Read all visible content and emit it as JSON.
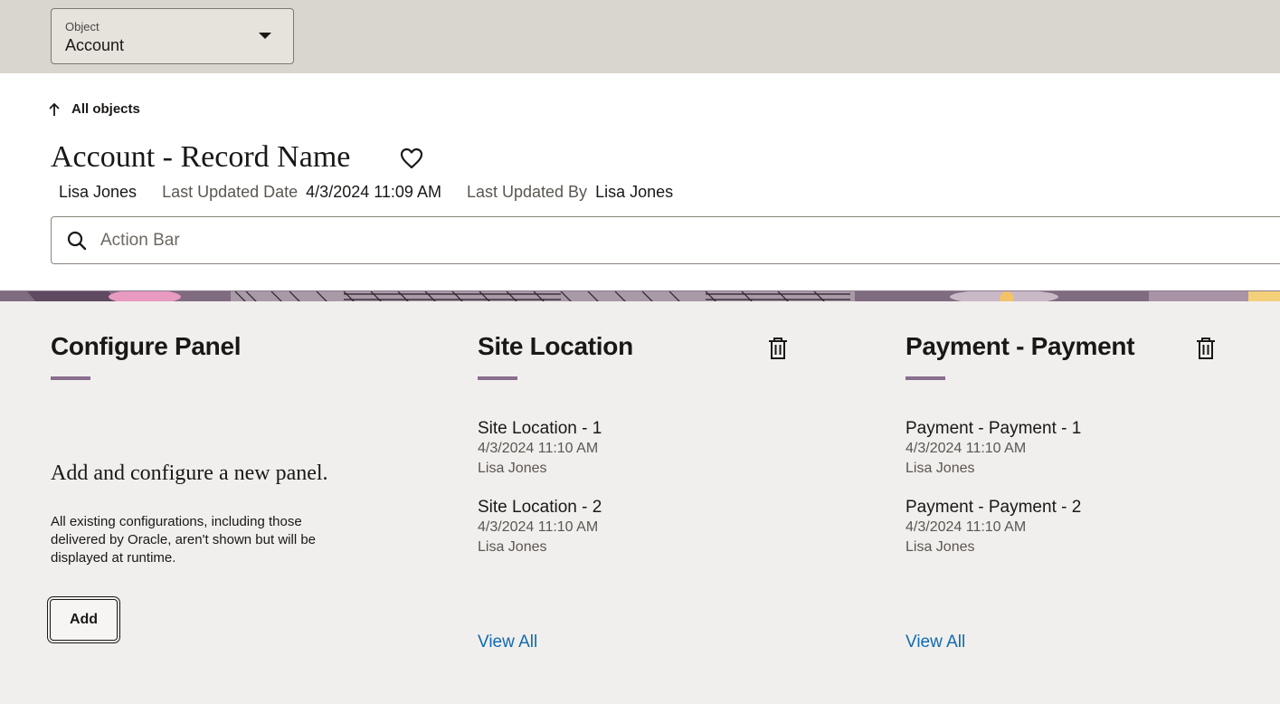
{
  "object_selector": {
    "label": "Object",
    "value": "Account"
  },
  "header": {
    "back_link": "All objects",
    "title": "Account - Record Name",
    "owner": "Lisa Jones",
    "last_updated_date_label": "Last Updated Date",
    "last_updated_date": "4/3/2024 11:09 AM",
    "last_updated_by_label": "Last Updated By",
    "last_updated_by": "Lisa Jones",
    "action_bar_placeholder": "Action Bar"
  },
  "panels": {
    "configure": {
      "title": "Configure Panel",
      "message": "Add and configure a new panel.",
      "note": "All existing configurations, including those delivered by Oracle, aren't shown but will be displayed at runtime.",
      "add_label": "Add"
    },
    "site_location": {
      "title": "Site Location",
      "records": [
        {
          "title": "Site Location - 1",
          "date": "4/3/2024 11:10 AM",
          "user": "Lisa Jones"
        },
        {
          "title": "Site Location - 2",
          "date": "4/3/2024 11:10 AM",
          "user": "Lisa Jones"
        }
      ],
      "view_all": "View All"
    },
    "payment": {
      "title": "Payment - Payment",
      "records": [
        {
          "title": "Payment - Payment - 1",
          "date": "4/3/2024 11:10 AM",
          "user": "Lisa Jones"
        },
        {
          "title": "Payment - Payment - 2",
          "date": "4/3/2024 11:10 AM",
          "user": "Lisa Jones"
        }
      ],
      "view_all": "View All"
    }
  },
  "colors": {
    "accent": "#8a6e8e",
    "link": "#0f6bb0",
    "top_band": "#d9d5cf",
    "panel_bg": "#f1efed"
  },
  "icons": [
    "chevron-down-icon",
    "arrow-up-icon",
    "heart-icon",
    "search-icon",
    "trash-icon"
  ]
}
